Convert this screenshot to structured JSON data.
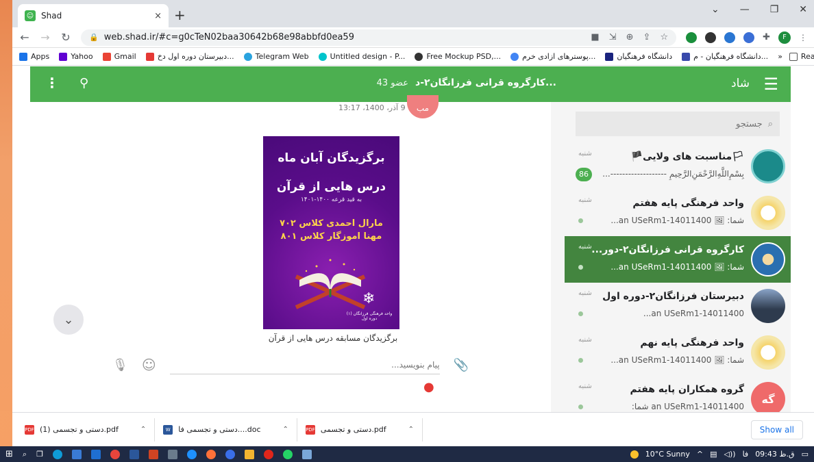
{
  "browser": {
    "tab_title": "Shad",
    "tab_close": "×",
    "new_tab": "+",
    "url": "web.shad.ir/#c=g0cTeN02baa30642b68e98abbfd0ea59",
    "profile_letter": "F",
    "window_controls": [
      "⌄",
      "—",
      "❐",
      "✕"
    ]
  },
  "bookmarks": {
    "items": [
      {
        "label": "Apps",
        "color": "#1a73e8"
      },
      {
        "label": "Yahoo",
        "color": "#6001d2"
      },
      {
        "label": "Gmail",
        "color": "#ea4335"
      },
      {
        "label": "دبیرستان دوره اول دخ...",
        "color": "#e53935"
      },
      {
        "label": "Telegram Web",
        "color": "#2aa3df"
      },
      {
        "label": "Untitled design - P...",
        "color": "#00c4cc"
      },
      {
        "label": "Free Mockup PSD,...",
        "color": "#333333"
      },
      {
        "label": "پوسترهای ازادی خرم...",
        "color": "#4285f4"
      },
      {
        "label": "دانشگاه فرهنگیان",
        "color": "#1a237e"
      },
      {
        "label": "دانشگاه فرهنگیان - م...",
        "color": "#3949ab"
      }
    ],
    "more": "»",
    "reading_list": "Reading li"
  },
  "appbar": {
    "brand": "شاد",
    "chat_name": "کارگروه قرانی فرزانگان۲-د...",
    "members": "43 عضو"
  },
  "message": {
    "sender_initials": "مب",
    "time": "9 آذر، 1400، 13:17",
    "poster_line1": "برگزیدگان آبان ماه",
    "poster_line2": "درس هایی از قرآن",
    "poster_sub": "به قید قرعه  ۱۴۰۰-۱۴۰۱",
    "poster_name1": "مارال احمدی کلاس ۷۰۲",
    "poster_name2": "مهنا اموزگار کلاس ۸۰۱",
    "poster_footer": "واحد فرهنگی فرزانگان (۱) دوره اول",
    "caption": "برگزیدگان مسابقه درس هایی از قرآن"
  },
  "composer": {
    "placeholder": "پیام بنویسید..."
  },
  "sidebar": {
    "search_placeholder": "جستجو",
    "chats": [
      {
        "name": "🏳مناسبت های ولایی🏴",
        "day": "شنبه",
        "last": "بِسْمِ‌اللَّهِ‌الرَّحْمَنِ‌الرَّحِيمِ -------------------...",
        "badge": "86",
        "active": false,
        "avatar_color": "#1b8a8a"
      },
      {
        "name": "واحد فرهنگی پایه هفتم",
        "day": "شنبه",
        "last": "شما: 🖼 an USeRm1-14011400...",
        "badge": "",
        "active": false,
        "avatar_color": "#f5e6a8"
      },
      {
        "name": "کارگروه قرانی فرزانگان۲-دور...",
        "day": "شنبه",
        "last": "شما: 🖼 an USeRm1-14011400...",
        "badge": "",
        "active": true,
        "avatar_color": "#2a6fb0"
      },
      {
        "name": "دبیرستان فرزانگان۲-دوره اول",
        "day": "شنبه",
        "last": "an USeRm1-14011400...",
        "badge": "",
        "active": false,
        "avatar_color": "#2e3b4e"
      },
      {
        "name": "واحد فرهنگی پایه نهم",
        "day": "شنبه",
        "last": "شما: 🖼 an USeRm1-14011400...",
        "badge": "",
        "active": false,
        "avatar_color": "#f5e6a8"
      },
      {
        "name": "گروه همکاران پایه هفتم",
        "day": "شنبه",
        "last": "an USeRm1-14011400 شما:",
        "badge": "",
        "active": false,
        "avatar_color": "#ef6a6a",
        "initials": "گه"
      }
    ]
  },
  "downloads": {
    "items": [
      {
        "label": "دستی و تجسمی (1).pdf",
        "type": "PDF",
        "color": "#e53935"
      },
      {
        "label": "دستی و تجسمی فا....doc",
        "type": "W",
        "color": "#2b579a"
      },
      {
        "label": "دستی و تجسمی.pdf",
        "type": "PDF",
        "color": "#e53935"
      }
    ],
    "show_all": "Show all"
  },
  "taskbar": {
    "weather": "10°C  Sunny",
    "time": "ق.ظ 09:43",
    "lang": "فا"
  }
}
